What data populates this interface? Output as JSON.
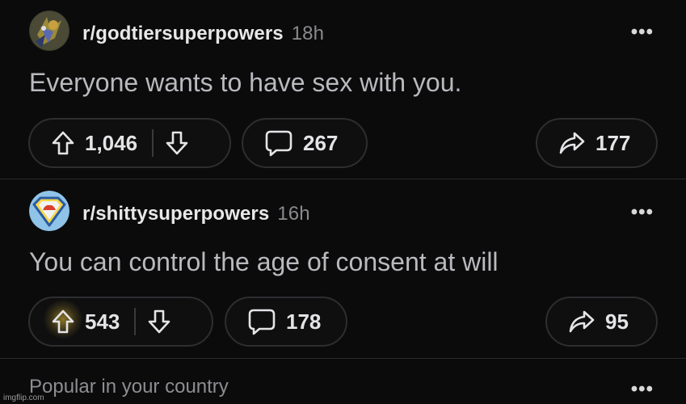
{
  "posts": [
    {
      "subreddit": "r/godtiersuperpowers",
      "age": "18h",
      "more": "•••",
      "title": "Everyone wants to have sex with you.",
      "upvotes": "1,046",
      "comments": "267",
      "shares": "177"
    },
    {
      "subreddit": "r/shittysuperpowers",
      "age": "16h",
      "more": "•••",
      "title": "You can control the age of consent at will",
      "upvotes": "543",
      "comments": "178",
      "shares": "95"
    }
  ],
  "footer": {
    "section_label": "Popular in your country",
    "more": "•••"
  },
  "watermark": "imgflip.com",
  "colors": {
    "background": "#0b0b0c",
    "title": "#b9b9be",
    "muted": "#8a8a8e",
    "pill_border": "#2e2e31"
  }
}
